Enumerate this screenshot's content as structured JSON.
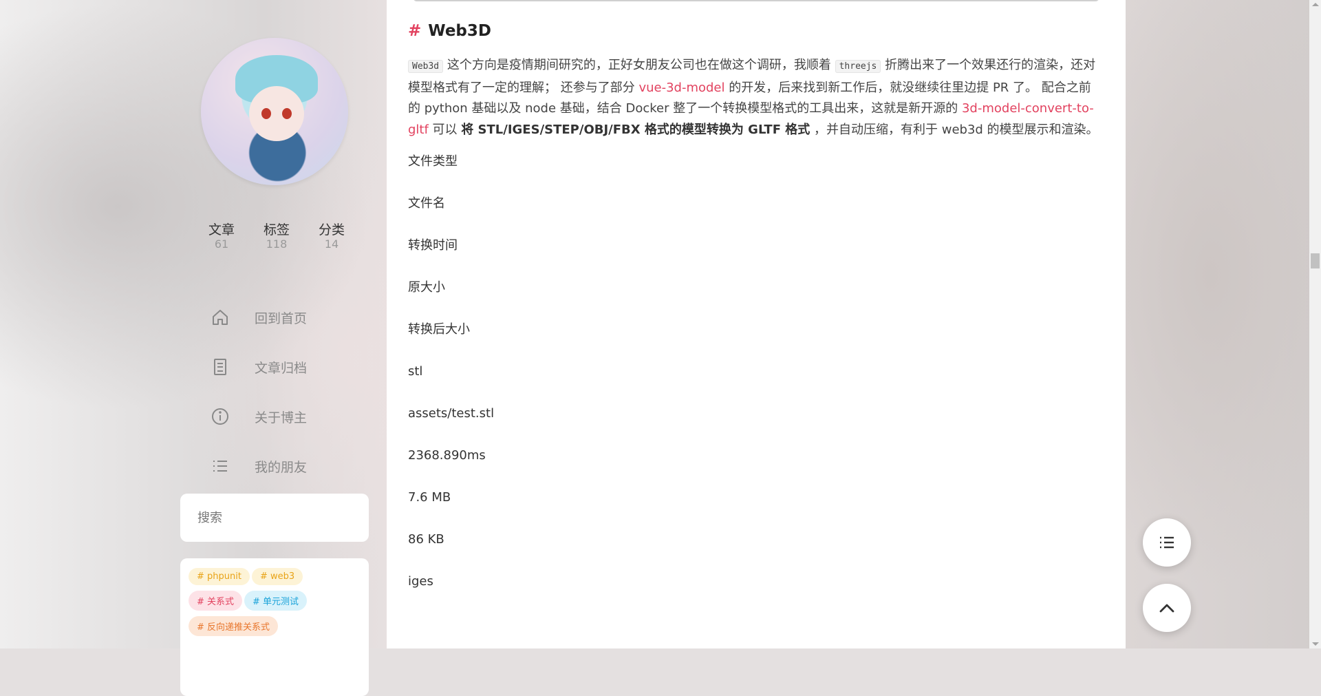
{
  "sidebar": {
    "stats": [
      {
        "label": "文章",
        "value": "61"
      },
      {
        "label": "标签",
        "value": "118"
      },
      {
        "label": "分类",
        "value": "14"
      }
    ],
    "menu": [
      {
        "label": "回到首页",
        "icon": "home-icon"
      },
      {
        "label": "文章归档",
        "icon": "archive-icon"
      },
      {
        "label": "关于博主",
        "icon": "info-icon"
      },
      {
        "label": "我的朋友",
        "icon": "list-icon"
      }
    ],
    "search_placeholder": "搜索",
    "tags": [
      {
        "label": "# phpunit",
        "color": "#e8a317",
        "bg": "#fdf3d6"
      },
      {
        "label": "# web3",
        "color": "#e8a317",
        "bg": "#fdf3d6"
      },
      {
        "label": "# 关系式",
        "color": "#e2425f",
        "bg": "#fde2e7"
      },
      {
        "label": "# 单元测试",
        "color": "#1aa3d9",
        "bg": "#d9f2fb"
      },
      {
        "label": "# 反向递推关系式",
        "color": "#e8772e",
        "bg": "#fde6d6"
      }
    ]
  },
  "article": {
    "heading_hash": "#",
    "heading": "Web3D",
    "para": {
      "code1": "Web3d",
      "t1": " 这个方向是疫情期间研究的，正好女朋友公司也在做这个调研，我顺着 ",
      "code2": "threejs",
      "t2": " 折腾出来了一个效果还行的渲染，还对模型格式有了一定的理解； 还参与了部分 ",
      "link1": "vue-3d-model",
      "t3": " 的开发，后来找到新工作后，就没继续往里边提 PR 了。 配合之前的 python 基础以及 node 基础，结合 Docker 整了一个转换模型格式的工具出来，这就是新开源的 ",
      "link2": "3d-model-convert-to-gltf",
      "t4": " 可以 ",
      "bold": "将 STL/IGES/STEP/OBJ/FBX 格式的模型转换为 GLTF 格式",
      "t5": " ，并自动压缩，有利于 web3d 的模型展示和渲染。"
    },
    "rows": [
      "文件类型",
      "文件名",
      "转换时间",
      "原大小",
      "转换后大小",
      "stl",
      "assets/test.stl",
      "2368.890ms",
      "7.6 MB",
      "86 KB",
      "iges"
    ]
  },
  "fabs": {
    "toc": "list-icon",
    "top": "chevron-up-icon"
  }
}
